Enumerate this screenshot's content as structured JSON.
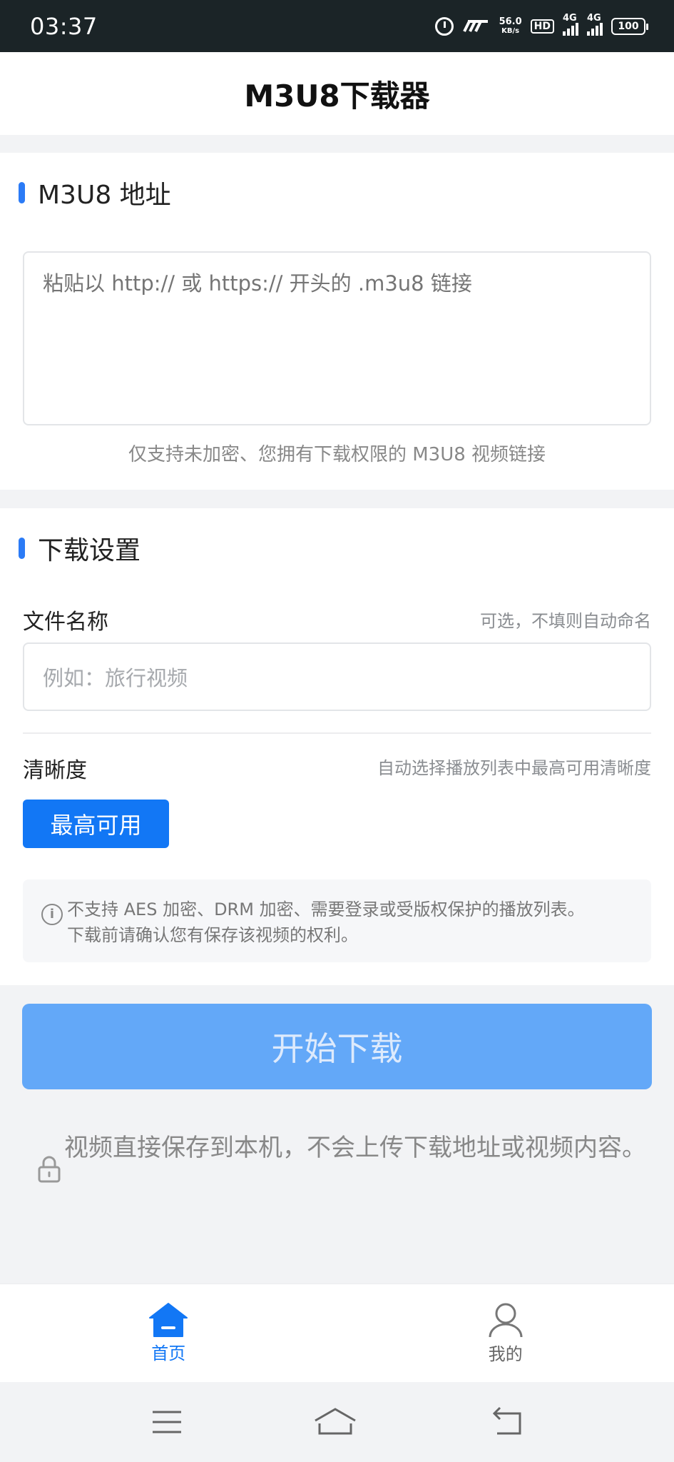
{
  "status_bar": {
    "time": "03:37",
    "speed_value": "56.0",
    "speed_unit": "KB/s",
    "hd": "HD",
    "network_1": "4G",
    "network_2": "4G",
    "battery": "100"
  },
  "header": {
    "title": "M3U8下载器"
  },
  "url_section": {
    "title": "M3U8 地址",
    "placeholder": "粘贴以 http:// 或 https:// 开头的 .m3u8 链接",
    "hint": "仅支持未加密、您拥有下载权限的 M3U8 视频链接"
  },
  "settings_section": {
    "title": "下载设置",
    "filename_label": "文件名称",
    "filename_aside": "可选，不填则自动命名",
    "filename_placeholder": "例如：旅行视频",
    "quality_label": "清晰度",
    "quality_aside": "自动选择播放列表中最高可用清晰度",
    "quality_selected": "最高可用",
    "notice_line1": "不支持 AES 加密、DRM 加密、需要登录或受版权保护的播放列表。",
    "notice_line2": "下载前请确认您有保存该视频的权利。"
  },
  "actions": {
    "start_label": "开始下载",
    "privacy_note": "视频直接保存到本机，不会上传下载地址或视频内容。"
  },
  "tabs": [
    {
      "label": "首页",
      "icon": "home-icon",
      "active": true
    },
    {
      "label": "我的",
      "icon": "user-icon",
      "active": false
    }
  ],
  "colors": {
    "accent": "#1277f5",
    "button_disabled": "#63a8f8",
    "status_bar": "#1b2427"
  }
}
